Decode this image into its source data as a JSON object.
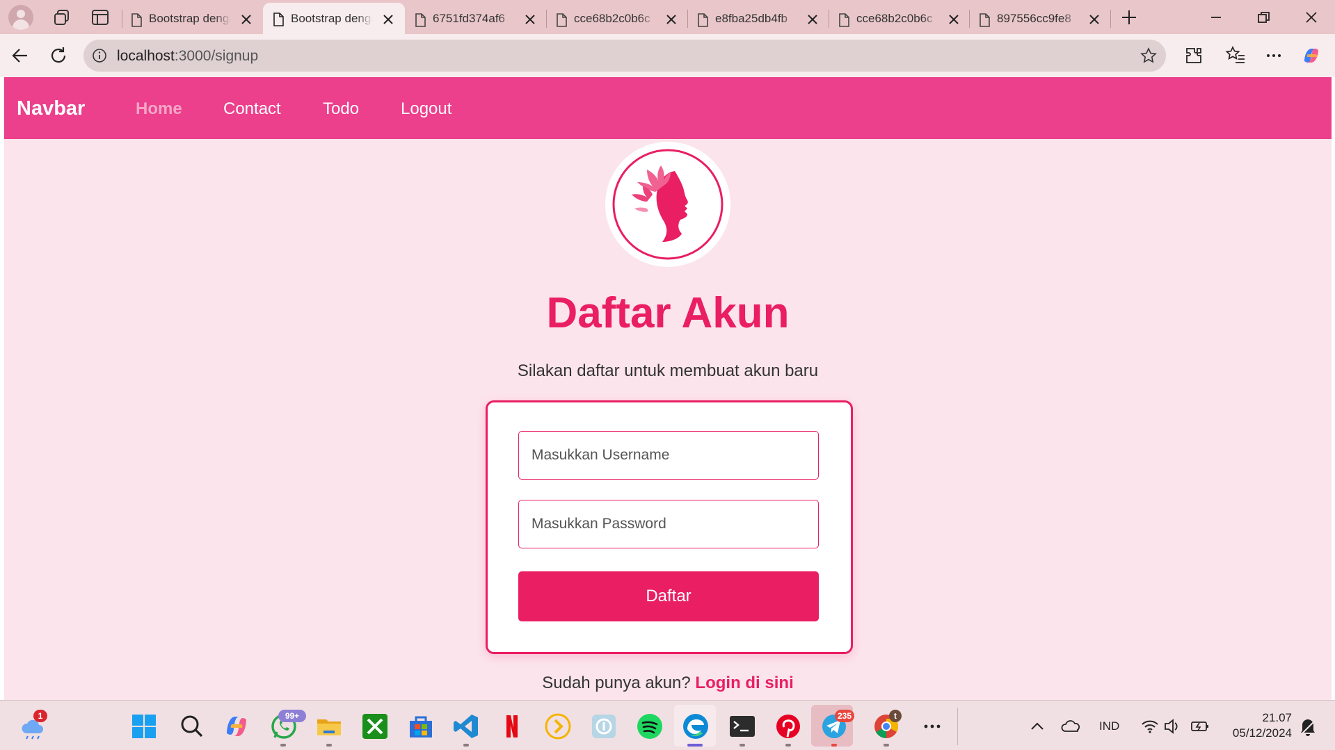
{
  "browser": {
    "tabs": [
      {
        "title": "Bootstrap dengan",
        "active": false
      },
      {
        "title": "Bootstrap dengan",
        "active": true
      },
      {
        "title": "6751fd374af6",
        "active": false
      },
      {
        "title": "cce68b2c0b6c",
        "active": false
      },
      {
        "title": "e8fba25db4fb",
        "active": false
      },
      {
        "title": "cce68b2c0b6c",
        "active": false
      },
      {
        "title": "897556cc9fe8",
        "active": false
      }
    ],
    "url_host": "localhost",
    "url_rest": ":3000/signup"
  },
  "navbar": {
    "brand": "Navbar",
    "links": [
      "Home",
      "Contact",
      "Todo",
      "Logout"
    ],
    "active_link": "Home"
  },
  "signup": {
    "title": "Daftar Akun",
    "subtitle": "Silakan daftar untuk membuat akun baru",
    "username_placeholder": "Masukkan Username",
    "password_placeholder": "Masukkan Password",
    "submit_label": "Daftar",
    "login_prompt": "Sudah punya akun?",
    "login_link": "Login di sini"
  },
  "taskbar": {
    "weather_badge": "1",
    "whatsapp_badge": "99+",
    "telegram_badge": "235",
    "chrome_badge": "t",
    "language": "IND",
    "time": "21.07",
    "date": "05/12/2024"
  },
  "colors": {
    "navbar_bg": "#ec3f8c",
    "accent": "#e91e63",
    "page_bg": "#fce4ec",
    "tabstrip_bg": "#e9c6c9"
  },
  "icons": [
    "profile-avatar-icon",
    "workspaces-icon",
    "vertical-tabs-icon",
    "document-icon",
    "close-icon",
    "new-tab-icon",
    "minimize-icon",
    "restore-icon",
    "back-arrow-icon",
    "reload-icon",
    "info-icon",
    "favorite-star-icon",
    "extensions-icon",
    "favorites-icon",
    "more-icon",
    "copilot-icon",
    "woman-silhouette-logo",
    "weather-icon",
    "windows-start-icon",
    "search-icon",
    "whatsapp-icon",
    "file-explorer-icon",
    "xbox-icon",
    "microsoft-store-icon",
    "vscode-icon",
    "netflix-icon",
    "plex-icon",
    "backup-icon",
    "spotify-icon",
    "edge-icon",
    "terminal-icon",
    "pinterest-icon",
    "telegram-icon",
    "chrome-icon",
    "chevron-up-icon",
    "onedrive-icon",
    "wifi-icon",
    "volume-icon",
    "battery-icon",
    "notification-icon"
  ]
}
